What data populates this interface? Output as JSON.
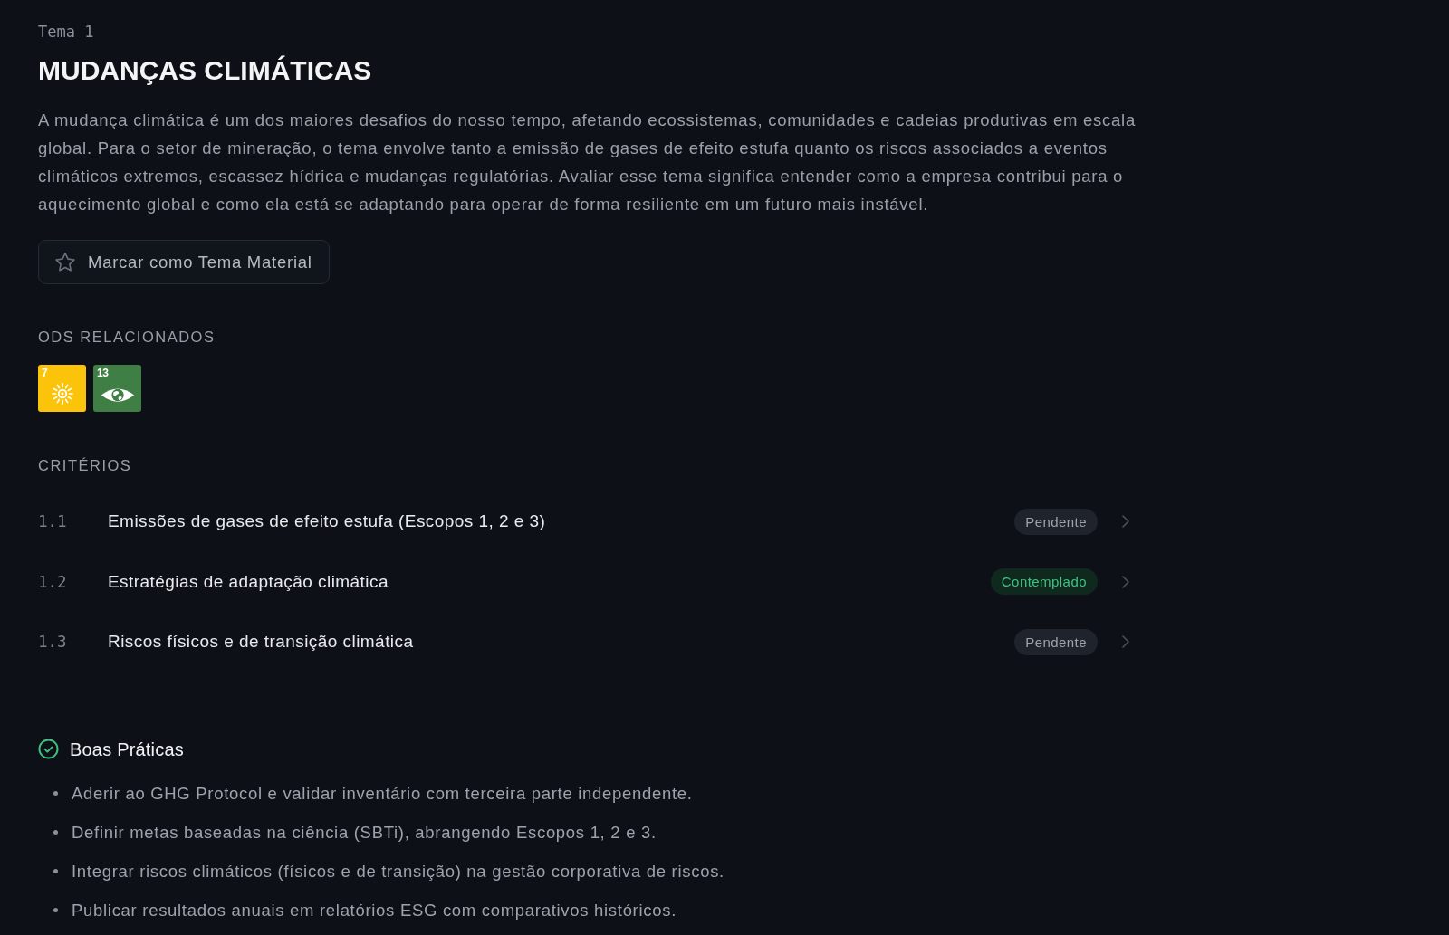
{
  "topic": {
    "label": "Tema 1",
    "title": "MUDANÇAS CLIMÁTICAS",
    "description": "A mudança climática é um dos maiores desafios do nosso tempo, afetando ecossistemas, comunidades e cadeias produtivas em escala global. Para o setor de mineração, o tema envolve tanto a emissão de gases de efeito estufa quanto os riscos associados a eventos climáticos extremos, escassez hídrica e mudanças regulatórias. Avaliar esse tema significa entender como a empresa contribui para o aquecimento global e como ela está se adaptando para operar de forma resiliente em um futuro mais instável."
  },
  "material_button": {
    "label": "Marcar como Tema Material"
  },
  "ods": {
    "heading": "ODS RELACIONADOS",
    "items": [
      {
        "number": "7",
        "color": "#fcc30b",
        "kind": "energy"
      },
      {
        "number": "13",
        "color": "#3f7e44",
        "kind": "climate"
      }
    ]
  },
  "criteria": {
    "heading": "CRITÉRIOS",
    "items": [
      {
        "number": "1.1",
        "title": "Emissões de gases de efeito estufa (Escopos 1, 2 e 3)",
        "status": {
          "label": "Pendente",
          "kind": "pending"
        }
      },
      {
        "number": "1.2",
        "title": "Estratégias de adaptação climática",
        "status": {
          "label": "Contemplado",
          "kind": "contemplated"
        }
      },
      {
        "number": "1.3",
        "title": "Riscos físicos e de transição climática",
        "status": {
          "label": "Pendente",
          "kind": "pending"
        }
      }
    ]
  },
  "good_practices": {
    "title": "Boas Práticas",
    "items": [
      "Aderir ao GHG Protocol e validar inventário com terceira parte independente.",
      "Definir metas baseadas na ciência (SBTi), abrangendo Escopos 1, 2 e 3.",
      "Integrar riscos climáticos (físicos e de transição) na gestão corporativa de riscos.",
      "Publicar resultados anuais em relatórios ESG com comparativos históricos."
    ]
  }
}
